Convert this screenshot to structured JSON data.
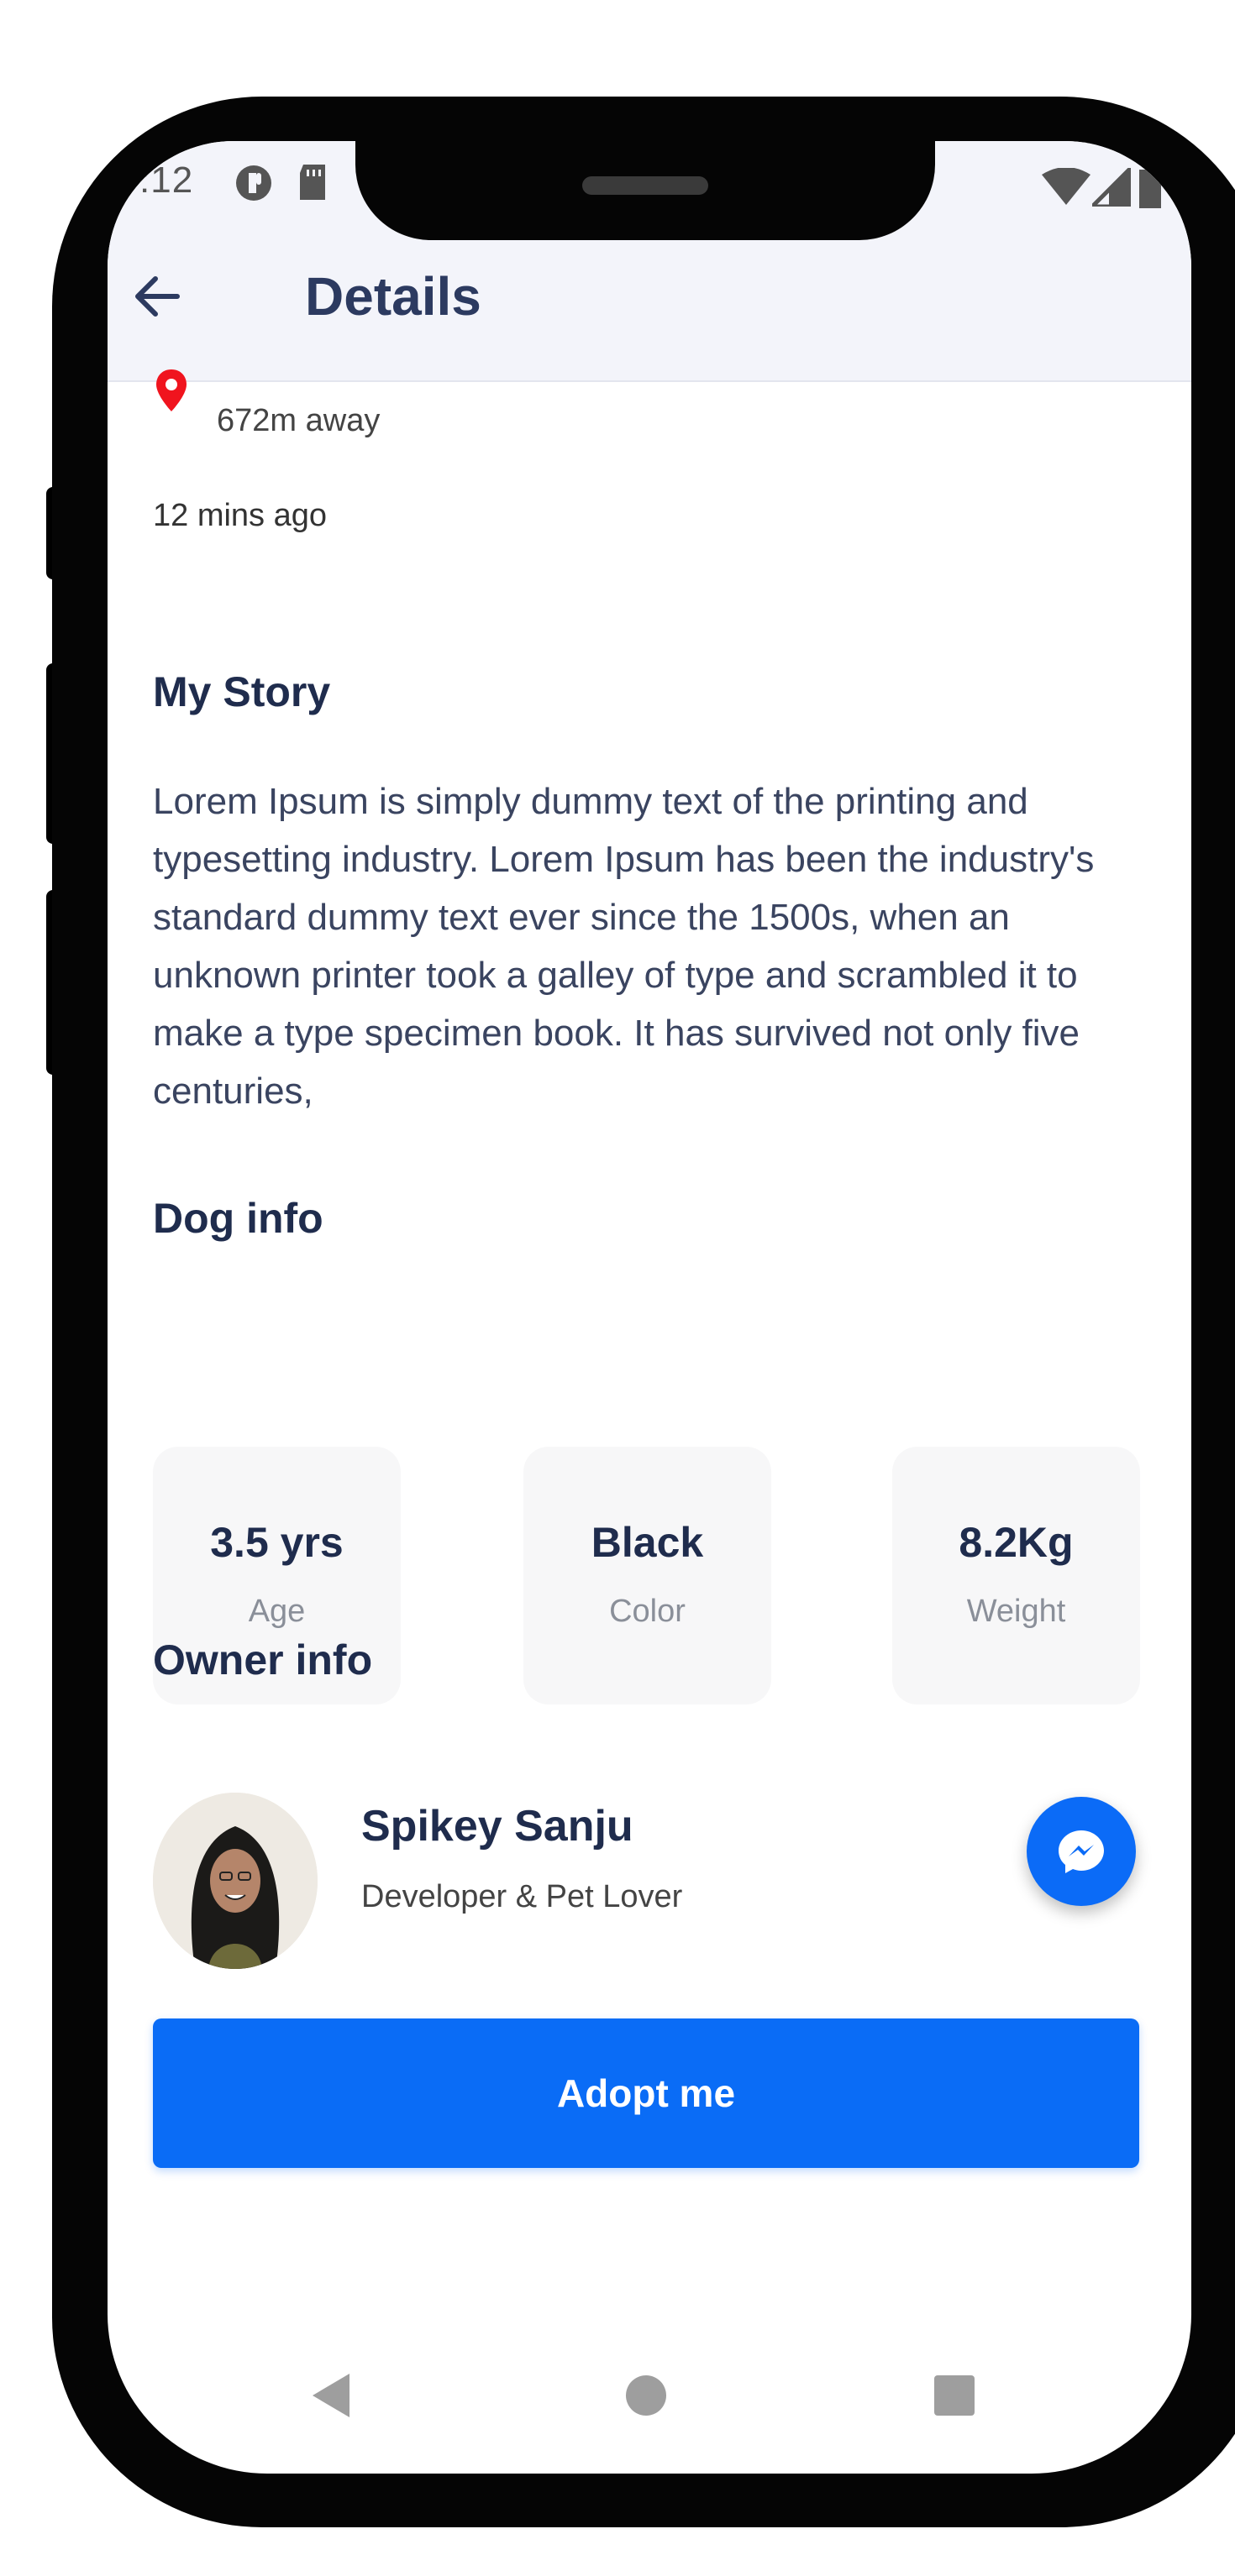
{
  "status_bar": {
    "time": ":12"
  },
  "header": {
    "title": "Details"
  },
  "location": {
    "distance": "672m away",
    "posted": "12 mins ago"
  },
  "story": {
    "heading": "My Story",
    "text": "Lorem Ipsum is simply dummy text of the printing and typesetting industry. Lorem Ipsum has been the industry's standard dummy text ever since the 1500s, when an unknown printer took a galley of type and scrambled it to make a type specimen book. It has survived not only five centuries,"
  },
  "dog_info": {
    "heading": "Dog info",
    "cards": [
      {
        "value": "3.5 yrs",
        "label": "Age"
      },
      {
        "value": "Black",
        "label": "Color"
      },
      {
        "value": "8.2Kg",
        "label": "Weight"
      }
    ]
  },
  "owner_info": {
    "heading": "Owner info",
    "name": "Spikey Sanju",
    "subtitle": "Developer & Pet Lover"
  },
  "adopt_button": {
    "label": "Adopt me"
  },
  "colors": {
    "accent": "#0a6cf6",
    "heading": "#1f2c4d",
    "appbar": "#f3f4fa",
    "pin": "#f0141e"
  },
  "icons": [
    "back-arrow-icon",
    "location-pin-icon",
    "messenger-icon",
    "nav-back-icon",
    "nav-home-icon",
    "nav-recents-icon"
  ]
}
